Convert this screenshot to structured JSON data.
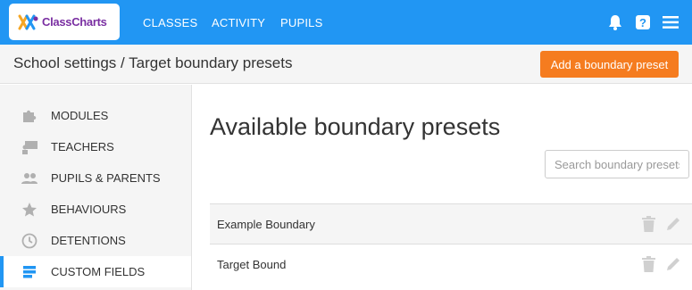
{
  "app": {
    "logo_text": "ClassCharts"
  },
  "nav": {
    "classes": "CLASSES",
    "activity": "ACTIVITY",
    "pupils": "PUPILS"
  },
  "header": {
    "breadcrumb": "School settings / Target boundary presets",
    "add_button": "Add a boundary preset"
  },
  "sidebar": {
    "items": [
      {
        "label": "MODULES",
        "icon": "puzzle-icon"
      },
      {
        "label": "TEACHERS",
        "icon": "teachers-icon"
      },
      {
        "label": "PUPILS & PARENTS",
        "icon": "people-icon"
      },
      {
        "label": "BEHAVIOURS",
        "icon": "star-icon"
      },
      {
        "label": "DETENTIONS",
        "icon": "clock-icon"
      },
      {
        "label": "CUSTOM FIELDS",
        "icon": "list-icon",
        "active": true
      }
    ]
  },
  "main": {
    "title": "Available boundary presets",
    "search_placeholder": "Search boundary presets",
    "rows": [
      {
        "name": "Example Boundary"
      },
      {
        "name": "Target Bound"
      }
    ]
  },
  "colors": {
    "brand_blue": "#2196f3",
    "accent_orange": "#f57c1f",
    "logo_purple": "#7a2fa2"
  }
}
